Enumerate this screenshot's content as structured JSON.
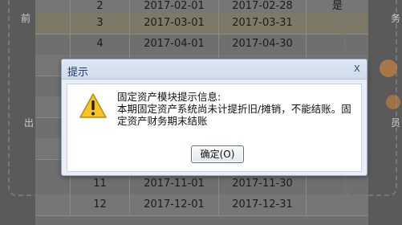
{
  "background": {
    "left_fragments": [
      "前",
      "出"
    ],
    "right_fragments": [
      "务",
      "员"
    ]
  },
  "table": {
    "rows": [
      {
        "num": "2",
        "start": "2017-02-01",
        "end": "2017-02-28",
        "flag": "是",
        "style": "alt"
      },
      {
        "num": "3",
        "start": "2017-03-01",
        "end": "2017-03-31",
        "flag": "",
        "style": "sel"
      },
      {
        "num": "4",
        "start": "2017-04-01",
        "end": "2017-04-30",
        "flag": "",
        "style": ""
      },
      {
        "num": "",
        "start": "",
        "end": "",
        "flag": "",
        "style": "alt"
      },
      {
        "num": "",
        "start": "",
        "end": "",
        "flag": "",
        "style": ""
      },
      {
        "num": "",
        "start": "",
        "end": "",
        "flag": "",
        "style": "alt"
      },
      {
        "num": "",
        "start": "",
        "end": "",
        "flag": "",
        "style": ""
      },
      {
        "num": "",
        "start": "",
        "end": "",
        "flag": "",
        "style": "alt"
      },
      {
        "num": "11",
        "start": "2017-11-01",
        "end": "2017-11-30",
        "flag": "",
        "style": ""
      },
      {
        "num": "12",
        "start": "2017-12-01",
        "end": "2017-12-31",
        "flag": "",
        "style": "alt"
      }
    ]
  },
  "dialog": {
    "title": "提示",
    "close": "x",
    "icon": "warning-icon",
    "message_lines": [
      "固定资产模块提示信息:",
      "本期固定资产系统尚未计提折旧/摊销，不能结账。固",
      "定资产财务期末结账"
    ],
    "ok_label": "确定(O)"
  }
}
